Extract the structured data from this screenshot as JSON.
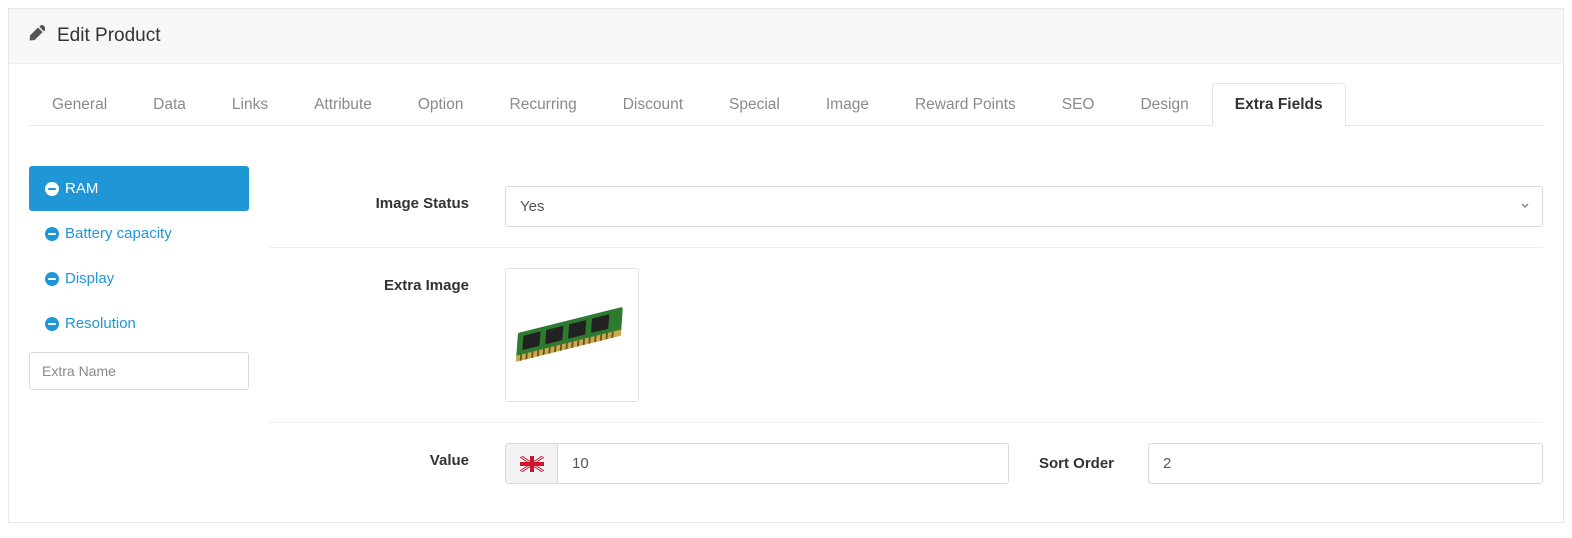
{
  "header": {
    "title": "Edit Product"
  },
  "tabs": [
    {
      "label": "General"
    },
    {
      "label": "Data"
    },
    {
      "label": "Links"
    },
    {
      "label": "Attribute"
    },
    {
      "label": "Option"
    },
    {
      "label": "Recurring"
    },
    {
      "label": "Discount"
    },
    {
      "label": "Special"
    },
    {
      "label": "Image"
    },
    {
      "label": "Reward Points"
    },
    {
      "label": "SEO"
    },
    {
      "label": "Design"
    },
    {
      "label": "Extra Fields"
    }
  ],
  "active_tab_index": 12,
  "sidebar": {
    "items": [
      {
        "label": "RAM"
      },
      {
        "label": "Battery capacity"
      },
      {
        "label": "Display"
      },
      {
        "label": "Resolution"
      }
    ],
    "active_index": 0,
    "input_placeholder": "Extra Name"
  },
  "form": {
    "image_status": {
      "label": "Image Status",
      "value": "Yes"
    },
    "extra_image": {
      "label": "Extra Image"
    },
    "value": {
      "label": "Value",
      "value": "10",
      "lang": "en-gb"
    },
    "sort_order": {
      "label": "Sort Order",
      "value": "2"
    }
  }
}
